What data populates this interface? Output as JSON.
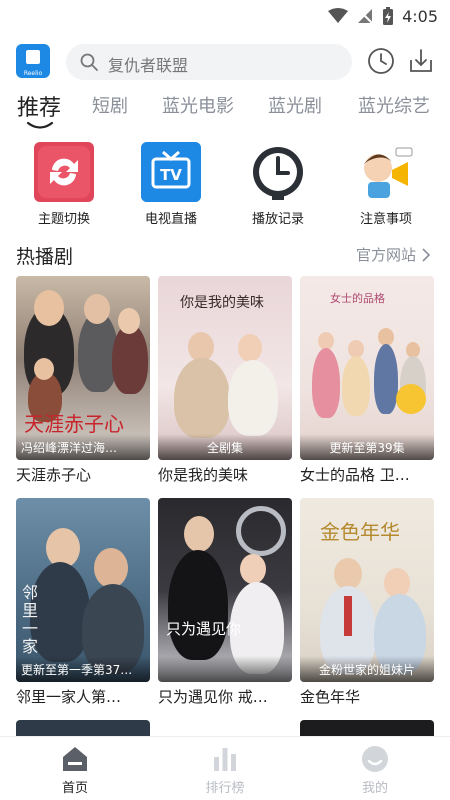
{
  "status_bar": {
    "time": "4:05"
  },
  "app": {
    "logo_text": "Reelio"
  },
  "search": {
    "placeholder": "复仇者联盟"
  },
  "tabs": [
    {
      "label": "推荐",
      "active": true
    },
    {
      "label": "短剧"
    },
    {
      "label": "蓝光电影"
    },
    {
      "label": "蓝光剧"
    },
    {
      "label": "蓝光综艺"
    }
  ],
  "shortcuts": [
    {
      "label": "主题切换",
      "icon": "theme-switch-icon"
    },
    {
      "label": "电视直播",
      "icon": "tv-live-icon"
    },
    {
      "label": "播放记录",
      "icon": "history-clock-icon"
    },
    {
      "label": "注意事项",
      "icon": "notice-megaphone-icon"
    }
  ],
  "section": {
    "title": "热播剧",
    "link": "官方网站"
  },
  "cards": [
    {
      "title": "天涯赤子心",
      "note": "冯绍峰漂洋过海…",
      "poster_title": "天涯赤子心"
    },
    {
      "title": "你是我的美味",
      "note": "全剧集",
      "poster_title": "你是我的美味"
    },
    {
      "title": "女士的品格 卫…",
      "note": "更新至第39集",
      "poster_title": "女士的品格"
    },
    {
      "title": "邻里一家人第…",
      "note": "更新至第一季第37…",
      "poster_title": "邻里一家"
    },
    {
      "title": "只为遇见你 戒…",
      "note": "",
      "poster_title": "只为遇见你"
    },
    {
      "title": "金色年华",
      "note": "金粉世家的姐妹片",
      "poster_title": "金色年华"
    }
  ],
  "bottom_nav": [
    {
      "label": "首页",
      "active": true
    },
    {
      "label": "排行榜"
    },
    {
      "label": "我的"
    }
  ],
  "colors": {
    "accent": "#1e88e5",
    "muted": "#8a8f99",
    "search_bg": "#f2f3f5"
  }
}
